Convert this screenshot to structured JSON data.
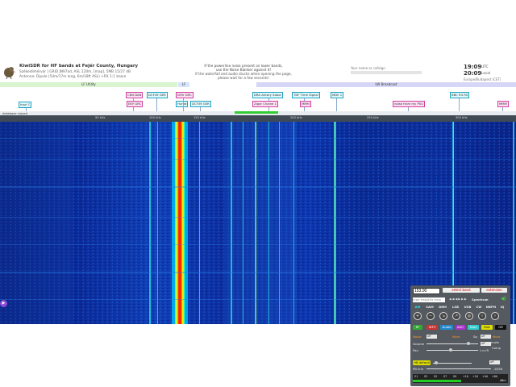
{
  "header": {
    "title": "KiwiSDR for HF bands at Fejér County, Hungary",
    "location": "Székesfehérvár | GRID JN97ad, ASL 120m, [map], 5MB 15/27 dB",
    "antenna": "Antenna: Dipole (54m/17m long, 6m/18ft ASL) +RX 1:1 balun",
    "notice_lines": [
      "If the powerline noise present on lower bands,",
      "use the Noise Blanker against it!",
      "If the waterfall and audio stucks when opening the page,",
      "please wait for a few seconds!"
    ],
    "name_placeholder": "Your name or callsign",
    "time_utc": "19:09",
    "time_utc_label": "UTC",
    "time_local": "20:09",
    "time_local_label": "Local",
    "timezone": "Europe/Budapest (CET)"
  },
  "bands": [
    {
      "label": "LF Utility",
      "color": "#d8f5d0"
    },
    {
      "label": "LF",
      "color": "#d6e4ff"
    },
    {
      "label": "LW Broadcast",
      "color": "#d6d6f7"
    }
  ],
  "stations": [
    {
      "label": "Inari C",
      "style": "cyan"
    },
    {
      "label": "CKN DAN",
      "style": "pink"
    },
    {
      "label": "EKY GRC",
      "style": "pink"
    },
    {
      "label": "DCF49 GER",
      "style": "cyan"
    },
    {
      "label": "Hunat",
      "style": "cyan"
    },
    {
      "label": "DHV GRC",
      "style": "pink"
    },
    {
      "label": "DCF39 GER",
      "style": "cyan"
    },
    {
      "label": "DRA Antary Sabor",
      "style": "cyan"
    },
    {
      "label": "Zigor Chaine 1",
      "style": "pink"
    },
    {
      "label": "TDF Time Signal",
      "style": "cyan"
    },
    {
      "label": "MMM",
      "style": "pink"
    },
    {
      "label": "MDE 1",
      "style": "cyan"
    },
    {
      "label": "noise from my PSU",
      "style": "pink"
    },
    {
      "label": "BBC R4 RS",
      "style": "cyan"
    },
    {
      "label": "MMM",
      "style": "pink"
    }
  ],
  "scale": {
    "database_label": "database closed",
    "ticks": [
      "",
      "50 kHz",
      "100 kHz",
      "150 kHz",
      "200 kHz",
      "250 kHz",
      "300 kHz"
    ]
  },
  "panel": {
    "frequency": "153.00",
    "select_band": "select band",
    "extension": "extension",
    "spectrum_label": "Spectrum",
    "search_placeholder": "type freq/kHz help",
    "modes": [
      "AM",
      "SAM",
      "DRM",
      "LSB",
      "USB",
      "CW",
      "NBFM",
      "IQ"
    ],
    "buttons": [
      "RF",
      "WF3",
      "Audio",
      "AGC",
      "User",
      "Stat",
      "Off"
    ],
    "noise_label": "Noise",
    "noise_value": "off",
    "more_label": "More",
    "more2_label": "More",
    "squelch_label": "Sq",
    "mute_label": "mute",
    "comp_label": "Comp",
    "volume_label": "Volume",
    "volume_value": "off",
    "pan_label": "Pan",
    "lr_label": "L<>R",
    "hb_label": "HB default",
    "pb_label": "PB line",
    "readout_value": "-4558",
    "db_unit": "dBm",
    "smeter_scale": [
      "S1",
      "S3",
      "S5",
      "S7",
      "S9",
      "+10",
      "+20",
      "+40",
      "+60"
    ],
    "passband": "off"
  }
}
